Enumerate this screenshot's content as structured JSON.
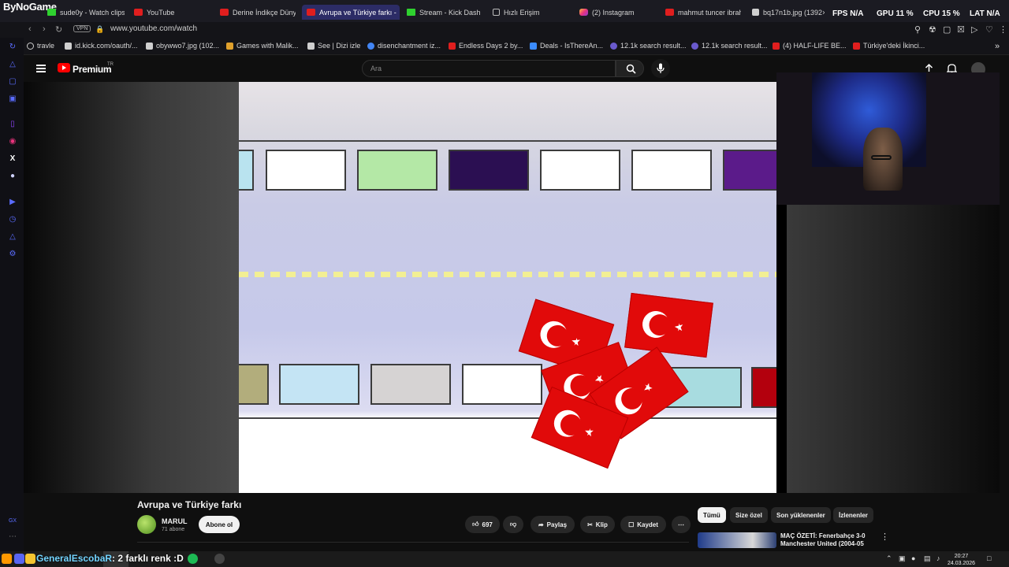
{
  "browser": {
    "overlay_brand": "ByNoGame",
    "tabs": [
      {
        "label": "sude0y - Watch clips",
        "icon": "kick-icon"
      },
      {
        "label": "YouTube",
        "icon": "youtube-icon"
      },
      {
        "label": "Derine İndikçe Dünya",
        "icon": "youtube-icon"
      },
      {
        "label": "Avrupa ve Türkiye farkı -",
        "icon": "youtube-icon",
        "active": true
      },
      {
        "label": "Stream - Kick Dashbo",
        "icon": "kick-icon"
      },
      {
        "label": "Hızlı Erişim",
        "icon": "grid-icon"
      },
      {
        "label": "(2) Instagram",
        "icon": "instagram-icon"
      },
      {
        "label": "mahmut tuncer ibrah",
        "icon": "youtube-icon"
      },
      {
        "label": "bq17n1b.jpg (1392×7",
        "icon": "document-icon"
      }
    ],
    "hud": {
      "fps_label": "FPS",
      "fps_value": "N/A",
      "gpu_label": "GPU",
      "gpu_value": "11 %",
      "cpu_label": "CPU",
      "cpu_value": "15 %",
      "lat_label": "LAT",
      "lat_value": "N/A"
    },
    "address": {
      "vpn": "VPN",
      "url": "www.youtube.com/watch"
    },
    "bookmarks": [
      "travle",
      "id.kick.com/oauth/...",
      "obywwo7.jpg (102...",
      "Games with Malik...",
      "See | Dizi izle",
      "disenchantment iz...",
      "Endless Days 2 by...",
      "Deals - IsThereAn...",
      "12.1k search result...",
      "12.1k search result...",
      "(4) HALF-LIFE BE...",
      "Türkiye'deki İkinci..."
    ]
  },
  "youtube": {
    "brand": "Premium",
    "brand_sup": "TR",
    "search_placeholder": "Ara",
    "video": {
      "title": "Avrupa ve Türkiye farkı",
      "channel": "MARUL",
      "subscribers": "71 abone",
      "subscribe_label": "Abone ol",
      "likes": "697",
      "share_label": "Paylaş",
      "clip_label": "Klip",
      "save_label": "Kaydet"
    },
    "chips": [
      "Tümü",
      "Size özel",
      "Son yüklenenler",
      "İzlenenler"
    ],
    "recommendation": {
      "title": "MAÇ ÖZETİ: Fenerbahçe 3-0 Manchester United (2004-05"
    }
  },
  "taskbar": {
    "chat_user": "GeneralEscobaR",
    "chat_message": ": 2 farklı renk :D",
    "time": "20:27",
    "date": "24.03.2026"
  },
  "colors": {
    "youtube_red": "#ff0000",
    "flag_red": "#e10a0a",
    "active_tab": "#2c2c66",
    "chat_user": "#73d4ff"
  }
}
